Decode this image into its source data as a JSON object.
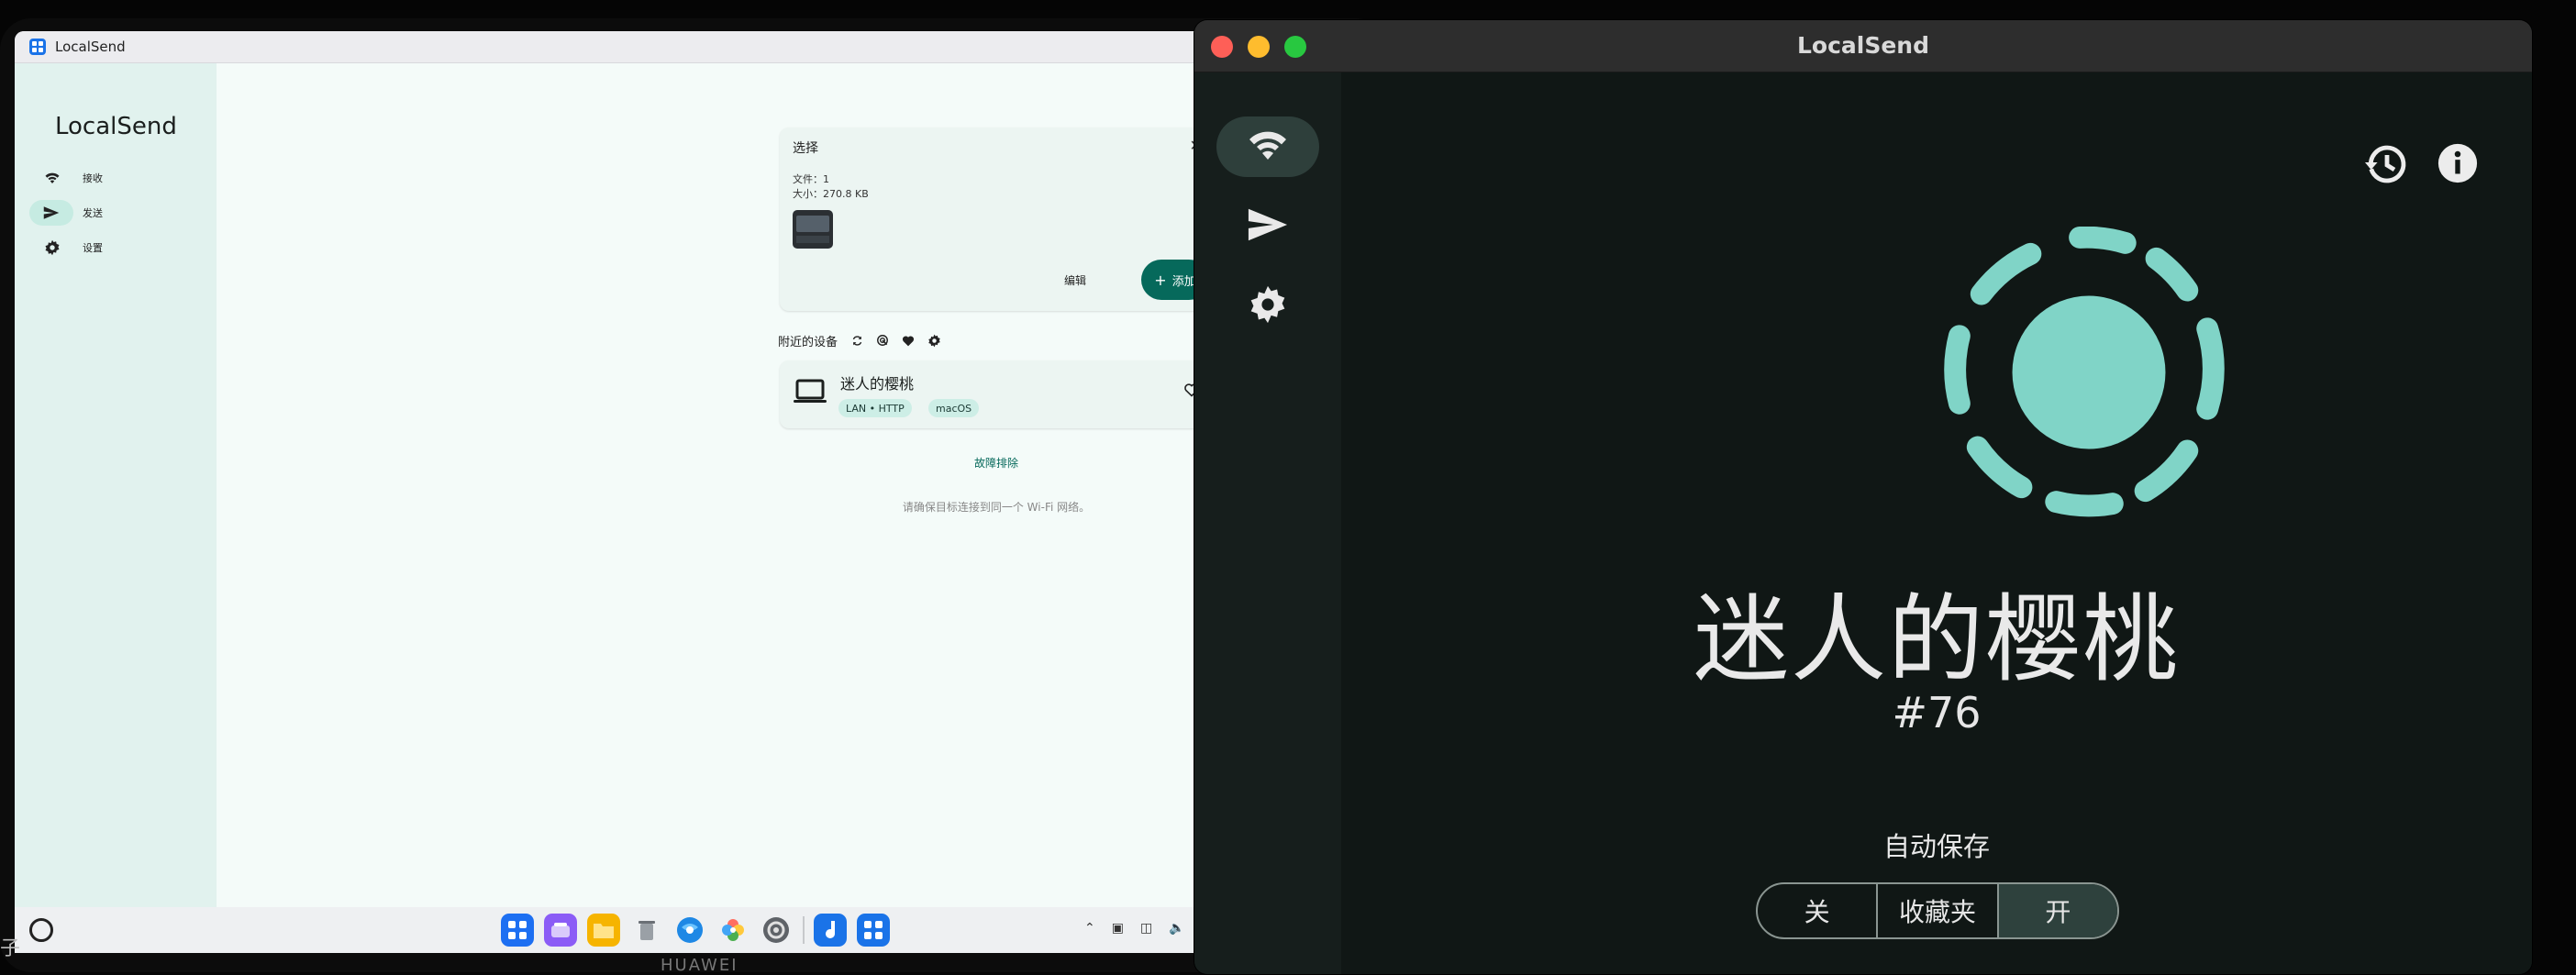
{
  "tablet": {
    "window_title": "LocalSend",
    "brand": "LocalSend",
    "nav": [
      {
        "label": "接收",
        "icon": "wifi-icon",
        "active": false
      },
      {
        "label": "发送",
        "icon": "send-icon",
        "active": true
      },
      {
        "label": "设置",
        "icon": "gear-icon",
        "active": false
      }
    ],
    "selection": {
      "title": "选择",
      "files_line": "文件：1",
      "size_line": "大小：270.8 KB",
      "edit_label": "编辑",
      "add_label": "添加"
    },
    "nearby": {
      "title": "附近的设备",
      "device_name": "迷人的樱桃",
      "chip_connection": "LAN • HTTP",
      "chip_os": "macOS"
    },
    "troubleshoot_label": "故障排除",
    "hint": "请确保目标连接到同一个 Wi-Fi 网络。",
    "bezel_brand": "HUAWEI",
    "edge_char": "子"
  },
  "mac": {
    "window_title": "LocalSend",
    "device_name": "迷人的樱桃",
    "device_tag": "#76",
    "auto_save_label": "自动保存",
    "auto_save_options": [
      "关",
      "收藏夹",
      "开"
    ],
    "auto_save_selected": "开"
  },
  "colors": {
    "accent_teal": "#06695b",
    "logo_teal": "#80d4c7",
    "mac_background": "#101715",
    "rail_active": "#2e3f3b"
  }
}
